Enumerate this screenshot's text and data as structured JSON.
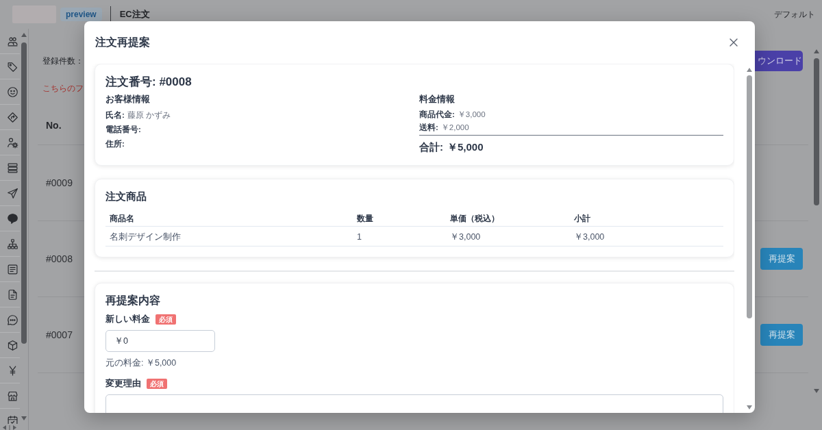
{
  "header": {
    "badge": "preview",
    "title": "EC注文",
    "view_menu": "デフォルト"
  },
  "page": {
    "count_label": "登録件数：",
    "notice": "こちらのフ",
    "download_button": "ウンロード",
    "table": {
      "columns": [
        "No."
      ],
      "rows": [
        {
          "no": "#0009"
        },
        {
          "no": "#0008",
          "action": "再提案"
        },
        {
          "no": "#0007",
          "action": "再提案"
        }
      ]
    }
  },
  "modal": {
    "title": "注文再提案",
    "order_summary": {
      "heading": "注文番号: #0008",
      "customer": {
        "heading": "お客様情報",
        "fields": [
          {
            "label": "氏名:",
            "value": "藤原 かずみ"
          },
          {
            "label": "電話番号:"
          },
          {
            "label": "住所:"
          }
        ]
      },
      "pricing": {
        "heading": "料金情報",
        "fields": [
          {
            "label": "商品代金:",
            "value": "￥3,000"
          },
          {
            "label": "送料:",
            "value": "￥2,000"
          }
        ],
        "total": {
          "label": "合計:",
          "value": "￥5,000"
        }
      }
    },
    "items": {
      "heading": "注文商品",
      "columns": [
        "商品名",
        "数量",
        "単価（税込）",
        "小計"
      ],
      "rows": [
        [
          "名刺デザイン制作",
          "1",
          "￥3,000",
          "￥3,000"
        ]
      ]
    },
    "reproposal": {
      "heading": "再提案内容",
      "fields": [
        {
          "kind": "input",
          "label": "新しい料金",
          "badge": "必須",
          "value": "￥0",
          "hint": "元の料金: ￥5,000"
        },
        {
          "kind": "textarea",
          "label": "変更理由",
          "badge": "必須"
        }
      ]
    }
  }
}
